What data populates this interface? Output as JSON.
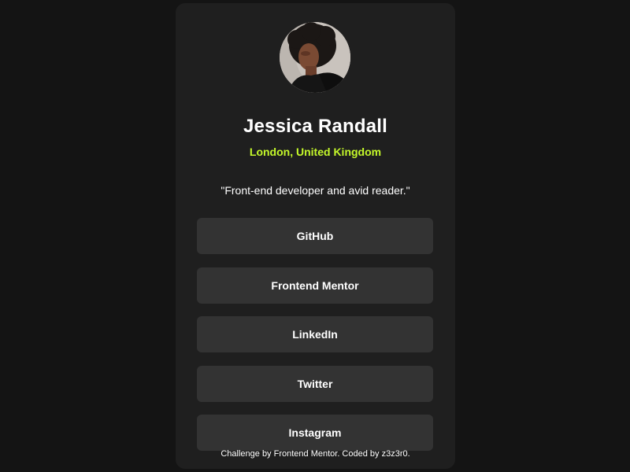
{
  "profile": {
    "name": "Jessica Randall",
    "location": "London, United Kingdom",
    "bio": "\"Front-end developer and avid reader.\"",
    "avatar_icon": "profile-photo"
  },
  "links": [
    {
      "label": "GitHub"
    },
    {
      "label": "Frontend Mentor"
    },
    {
      "label": "LinkedIn"
    },
    {
      "label": "Twitter"
    },
    {
      "label": "Instagram"
    }
  ],
  "footer": {
    "text": "Challenge by Frontend Mentor. Coded by z3z3r0."
  },
  "colors": {
    "page_background": "#141414",
    "card_background": "#1f1f1f",
    "button_background": "#333333",
    "accent_green": "#c4f82a",
    "text": "#ffffff"
  }
}
